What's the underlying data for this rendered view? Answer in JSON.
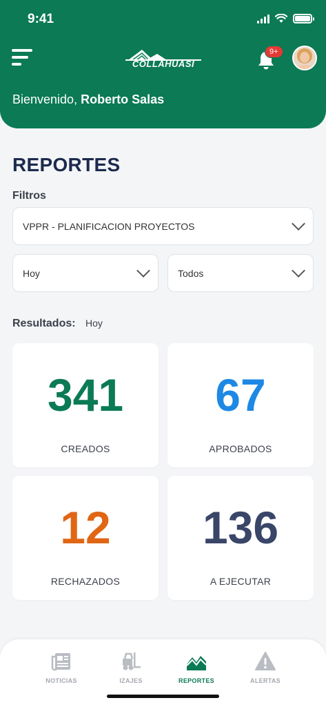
{
  "status_bar": {
    "time": "9:41"
  },
  "header": {
    "logo_text": "COLLAHUASI",
    "notification_badge": "9+",
    "greeting": "Bienvenido,",
    "user_name": "Roberto Salas"
  },
  "page": {
    "title": "REPORTES",
    "filters_label": "Filtros",
    "filter_area": "VPPR - PLANIFICACION PROYECTOS",
    "filter_period": "Hoy",
    "filter_status": "Todos",
    "results_label": "Resultados:",
    "results_value": "Hoy"
  },
  "stats": [
    {
      "value": "341",
      "label": "CREADOS",
      "color": "#0b7a55"
    },
    {
      "value": "67",
      "label": "APROBADOS",
      "color": "#1e88e5"
    },
    {
      "value": "12",
      "label": "RECHAZADOS",
      "color": "#e06614"
    },
    {
      "value": "136",
      "label": "A EJECUTAR",
      "color": "#3a4668"
    }
  ],
  "tabs": [
    {
      "label": "NOTICIAS",
      "icon": "newspaper-icon"
    },
    {
      "label": "IZAJES",
      "icon": "forklift-icon"
    },
    {
      "label": "REPORTES",
      "icon": "mountain-chart-icon"
    },
    {
      "label": "ALERTAS",
      "icon": "warning-icon"
    }
  ],
  "colors": {
    "brand_green": "#0b7a55",
    "title_navy": "#1c2a4d",
    "tab_inactive": "#a3a7ae",
    "badge_red": "#e53935"
  }
}
